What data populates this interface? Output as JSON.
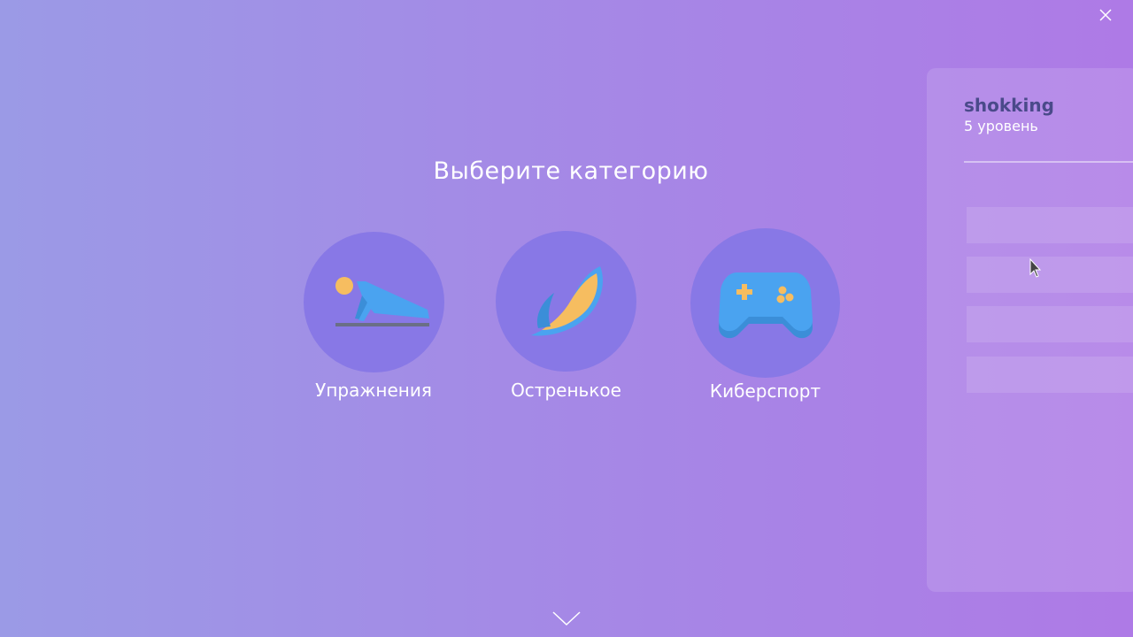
{
  "header": {
    "close_icon": "close-icon"
  },
  "main": {
    "title": "Выберите категорию",
    "categories": [
      {
        "label": "Упражнения",
        "icon": "pushup-icon"
      },
      {
        "label": "Остренькое",
        "icon": "chili-pepper-icon"
      },
      {
        "label": "Киберспорт",
        "icon": "gamepad-icon"
      }
    ],
    "scroll_icon": "chevron-down-icon"
  },
  "profile": {
    "username": "shokking",
    "level": "5 уровень",
    "slots": 4
  },
  "colors": {
    "circle": "#8878e6",
    "icon_blue": "#4aa3f0",
    "icon_orange": "#f6bd60",
    "username": "#4a4a8a"
  }
}
